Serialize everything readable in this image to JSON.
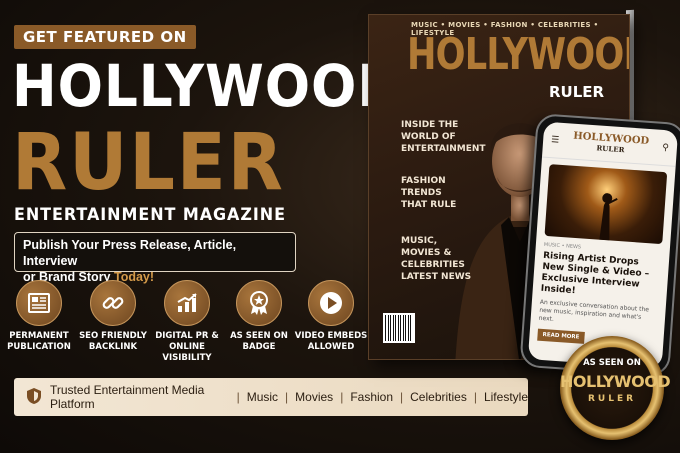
{
  "header": {
    "tag": "GET FEATURED ON",
    "title_line1": "HOLLYWOOD",
    "title_line2": "RULER",
    "subtitle": "ENTERTAINMENT MAGAZINE"
  },
  "pitch": {
    "line1": "Publish Your Press Release, Article, Interview",
    "line2": "or Brand Story",
    "highlight": "Today!"
  },
  "features": [
    {
      "icon": "newspaper-icon",
      "line1": "PERMANENT",
      "line2": "PUBLICATION"
    },
    {
      "icon": "link-icon",
      "line1": "SEO FRIENDLY",
      "line2": "BACKLINK"
    },
    {
      "icon": "growth-chart-icon",
      "line1": "DIGITAL PR &",
      "line2": "ONLINE VISIBILITY"
    },
    {
      "icon": "award-badge-icon",
      "line1": "AS SEEN ON",
      "line2": "BADGE"
    },
    {
      "icon": "play-icon",
      "line1": "VIDEO EMBEDS",
      "line2": "ALLOWED"
    }
  ],
  "trust_bar": {
    "text": "Trusted Entertainment Media Platform",
    "categories": [
      "Music",
      "Movies",
      "Fashion",
      "Celebrities",
      "Lifestyle"
    ]
  },
  "magazine": {
    "nav": "MUSIC • MOVIES • FASHION • CELEBRITIES • LIFESTYLE",
    "title": "HOLLYWOOD",
    "title2": "RULER",
    "cover_lines": [
      "INSIDE THE|WORLD OF|ENTERTAINMENT",
      "FASHION|TRENDS|THAT RULE",
      "MUSIC,|MOVIES &|CELEBRITIES|LATEST NEWS"
    ]
  },
  "phone": {
    "logo": "HOLLYWOOD",
    "logo_sub": "RULER",
    "crumb": "MUSIC • NEWS",
    "headline": "Rising Artist Drops New Single & Video – Exclusive Interview Inside!",
    "body": "An exclusive conversation about the new music, inspiration and what's next.",
    "button": "READ MORE"
  },
  "badge": {
    "line1": "AS SEEN ON",
    "line2": "HOLLYWOOD",
    "line3": "RULER"
  },
  "colors": {
    "accent": "#b07a36",
    "tag_bg": "#8a5a28",
    "trust_bg": "#f2e6d4"
  }
}
